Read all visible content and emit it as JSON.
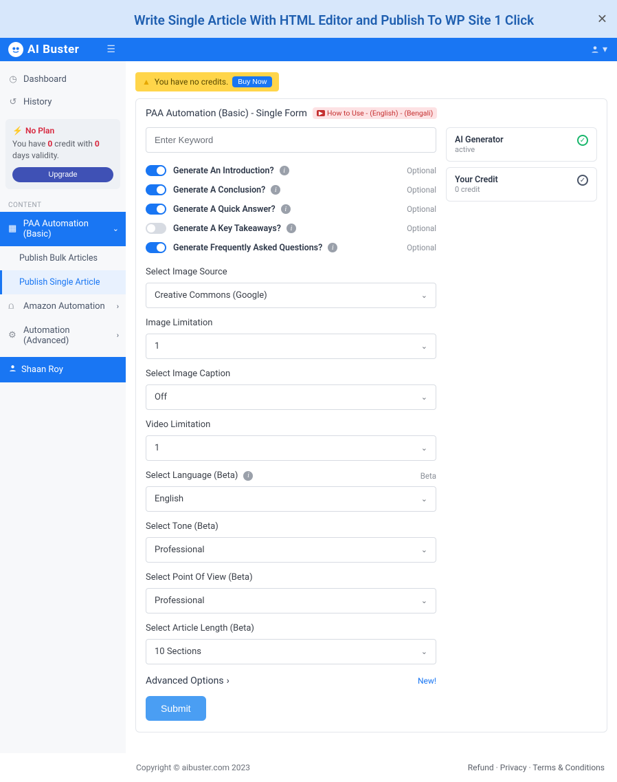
{
  "banner": {
    "title": "Write Single Article With HTML Editor and Publish To WP Site 1 Click"
  },
  "brand": "AI Buster",
  "sidebar": {
    "dashboard": "Dashboard",
    "history": "History",
    "plan": {
      "title": "No Plan",
      "text_pre": "You have ",
      "zero1": "0",
      "text_mid": " credit with ",
      "zero2": "0",
      "text_post": " days validity.",
      "upgrade": "Upgrade"
    },
    "section": "CONTENT",
    "nav": [
      {
        "label": "PAA Automation (Basic)"
      },
      {
        "label": "Amazon Automation"
      },
      {
        "label": "Automation (Advanced)"
      }
    ],
    "sub": [
      {
        "label": "Publish Bulk Articles"
      },
      {
        "label": "Publish Single Article"
      }
    ],
    "user": "Shaan Roy"
  },
  "alert": {
    "text": "You have no credits.",
    "buy": "Buy Now"
  },
  "card": {
    "title": "PAA Automation (Basic) - Single Form",
    "howto_prefix": "How to Use - ",
    "howto_en": "(English)",
    "howto_sep": " - ",
    "howto_bn": "(Bengali)"
  },
  "form": {
    "keyword_placeholder": "Enter Keyword",
    "toggles": [
      {
        "label": "Generate An Introduction?",
        "on": true
      },
      {
        "label": "Generate A Conclusion?",
        "on": true
      },
      {
        "label": "Generate A Quick Answer?",
        "on": true
      },
      {
        "label": "Generate A Key Takeaways?",
        "on": false
      },
      {
        "label": "Generate Frequently Asked Questions?",
        "on": true
      }
    ],
    "optional": "Optional",
    "img_source_label": "Select Image Source",
    "img_source_value": "Creative Commons (Google)",
    "img_limit_label": "Image Limitation",
    "img_limit_value": "1",
    "img_caption_label": "Select Image Caption",
    "img_caption_value": "Off",
    "vid_limit_label": "Video Limitation",
    "vid_limit_value": "1",
    "lang_label": "Select Language (Beta)",
    "lang_value": "English",
    "lang_beta": "Beta",
    "tone_label": "Select Tone (Beta)",
    "tone_value": "Professional",
    "pov_label": "Select Point Of View (Beta)",
    "pov_value": "Professional",
    "len_label": "Select Article Length (Beta)",
    "len_value": "10 Sections",
    "advanced": "Advanced Options",
    "new": "New!",
    "submit": "Submit"
  },
  "status": {
    "ai_title": "AI Generator",
    "ai_sub": "active",
    "credit_title": "Your Credit",
    "credit_sub": "0 credit"
  },
  "footer": {
    "copy": "Copyright © aibuster.com 2023",
    "links": [
      "Refund",
      "Privacy",
      "Terms & Conditions"
    ]
  }
}
